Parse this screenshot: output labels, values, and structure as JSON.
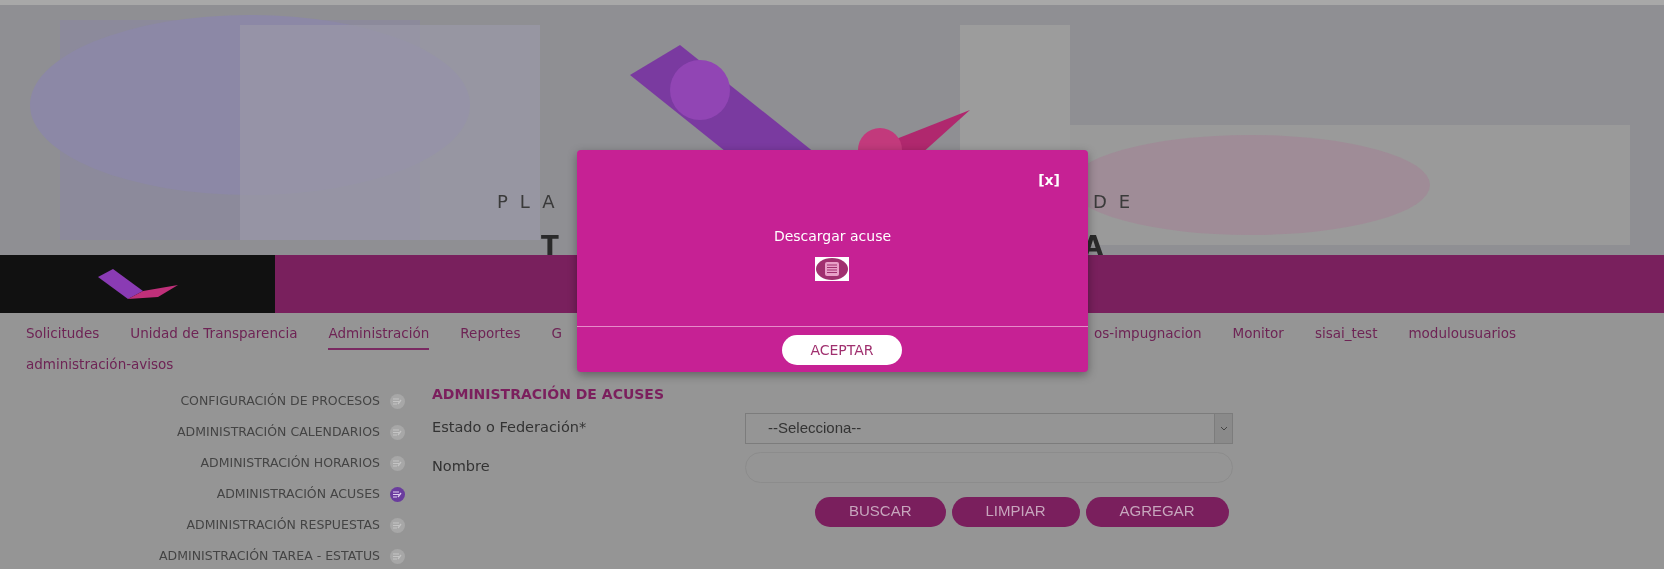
{
  "banner": {
    "texts": [
      "PLA",
      "DE",
      "T",
      "A"
    ]
  },
  "nav": {
    "items": [
      {
        "label": "Solicitudes",
        "selected": false
      },
      {
        "label": "Unidad de Transparencia",
        "selected": false
      },
      {
        "label": "Administración",
        "selected": true
      },
      {
        "label": "Reportes",
        "selected": false
      },
      {
        "label": "G",
        "selected": false,
        "kind": "cut"
      },
      {
        "label": "os-impugnacion",
        "selected": false
      },
      {
        "label": "Monitor",
        "selected": false
      },
      {
        "label": "sisai_test",
        "selected": false
      },
      {
        "label": "modulousuarios",
        "selected": false
      },
      {
        "label": "administración-avisos",
        "selected": false
      }
    ]
  },
  "sidebar": {
    "items": [
      {
        "label": "CONFIGURACIÓN DE PROCESOS",
        "selected": false
      },
      {
        "label": "ADMINISTRACIÓN CALENDARIOS",
        "selected": false
      },
      {
        "label": "ADMINISTRACIÓN HORARIOS",
        "selected": false
      },
      {
        "label": "ADMINISTRACIÓN ACUSES",
        "selected": true
      },
      {
        "label": "ADMINISTRACIÓN RESPUESTAS",
        "selected": false
      },
      {
        "label": "ADMINISTRACIÓN TAREA - ESTATUS",
        "selected": false
      }
    ]
  },
  "form": {
    "title": "ADMINISTRACIÓN DE ACUSES",
    "fields": [
      {
        "label": "Estado o Federación*",
        "kind": "select",
        "value": "--Selecciona--"
      },
      {
        "label": "Nombre",
        "kind": "text"
      }
    ],
    "buttons": [
      "BUSCAR",
      "LIMPIAR",
      "AGREGAR"
    ]
  },
  "modal": {
    "close": "[x]",
    "message": "Descargar acuse",
    "button": "ACEPTAR"
  }
}
